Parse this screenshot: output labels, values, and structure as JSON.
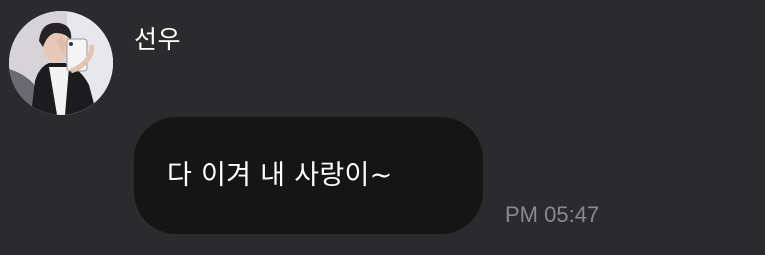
{
  "message": {
    "sender_name": "선우",
    "text": "다 이겨 내 사랑이~",
    "timestamp": "PM 05:47"
  },
  "colors": {
    "background": "#2b2b2e",
    "bubble": "#151516",
    "text": "#ffffff",
    "timestamp": "#8a8a8d"
  },
  "icons": {
    "avatar": "profile-photo"
  }
}
